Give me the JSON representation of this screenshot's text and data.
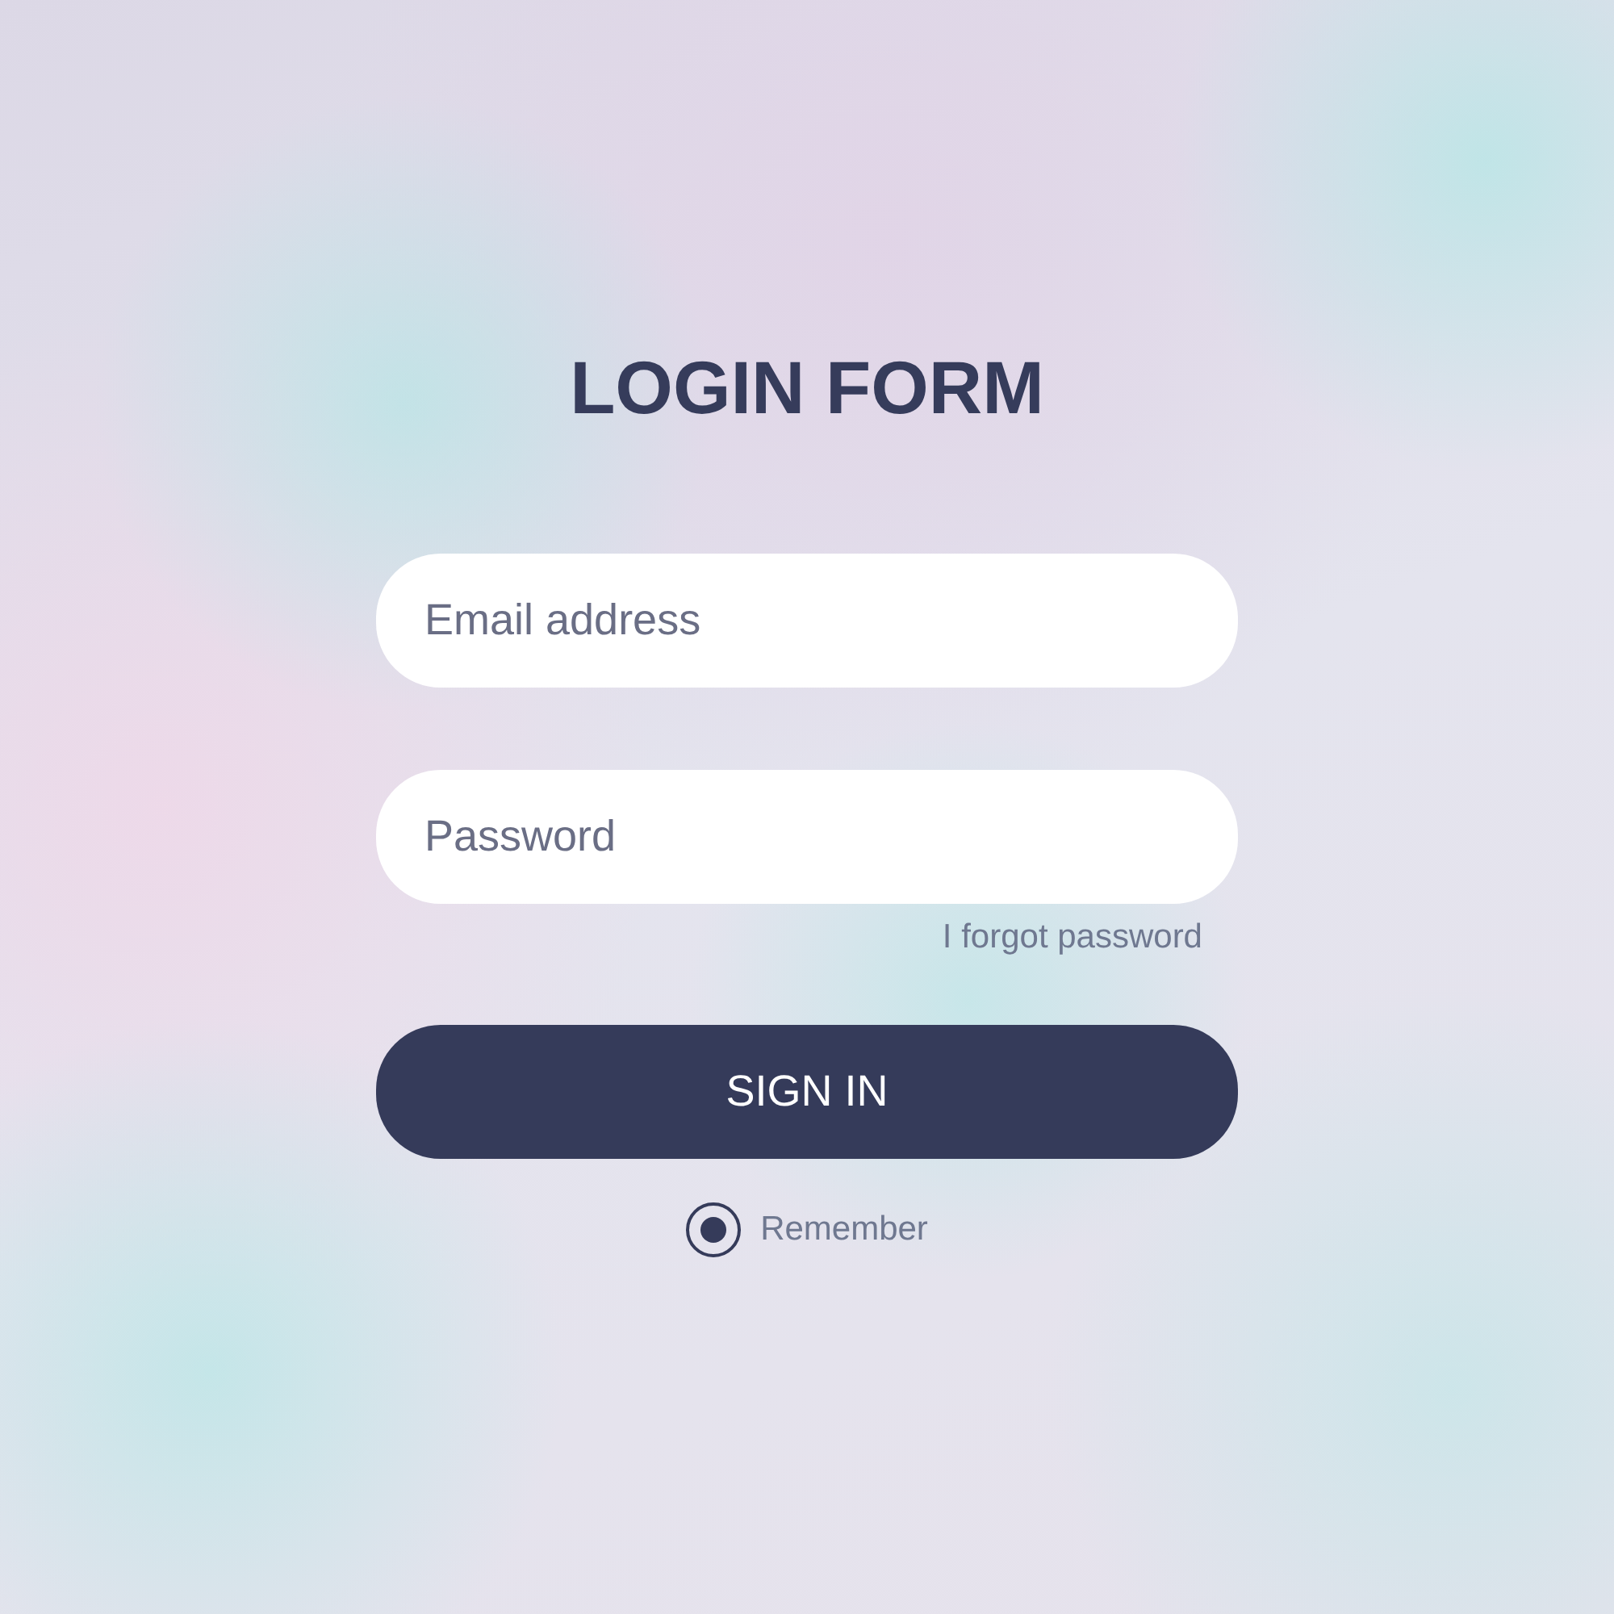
{
  "title": "LOGIN FORM",
  "email": {
    "placeholder": "Email address"
  },
  "password": {
    "placeholder": "Password"
  },
  "forgot_link": "I forgot password",
  "sign_in_button": "SIGN IN",
  "remember": {
    "label": "Remember",
    "selected": true
  }
}
